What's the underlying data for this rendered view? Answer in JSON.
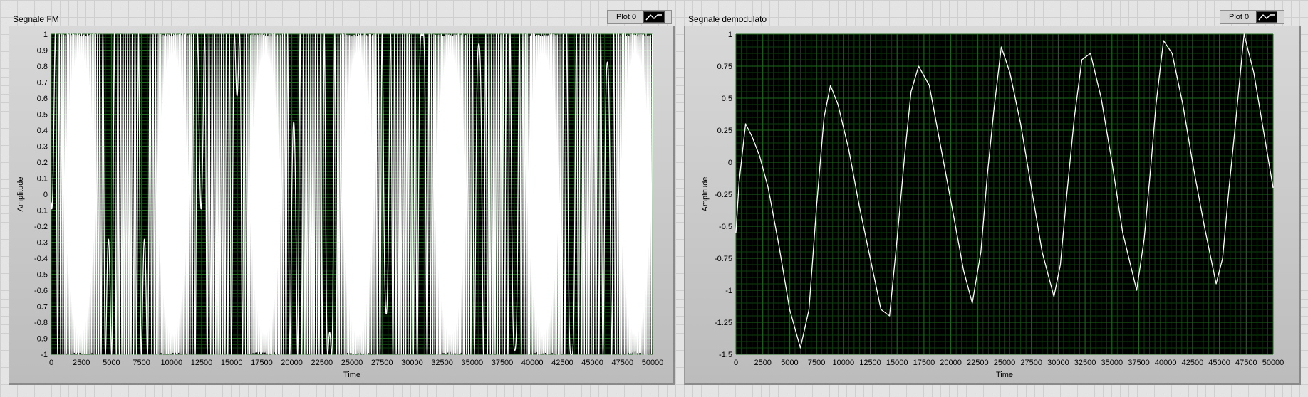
{
  "graphs": [
    {
      "title": "Segnale FM",
      "legend_label": "Plot 0",
      "chart_data": {
        "type": "line",
        "title": "Segnale FM",
        "xlabel": "Time",
        "ylabel": "Amplitude",
        "xlim": [
          0,
          50000
        ],
        "ylim": [
          -1,
          1
        ],
        "x_ticks": [
          "0",
          "2500",
          "5000",
          "7500",
          "10000",
          "12500",
          "15000",
          "17500",
          "20000",
          "22500",
          "25000",
          "27500",
          "30000",
          "32500",
          "35000",
          "37500",
          "40000",
          "42500",
          "45000",
          "47500",
          "50000"
        ],
        "y_ticks": [
          "1",
          "0.9",
          "0.8",
          "0.7",
          "0.6",
          "0.5",
          "0.4",
          "0.3",
          "0.2",
          "0.1",
          "0",
          "-0.1",
          "-0.2",
          "-0.3",
          "-0.4",
          "-0.5",
          "-0.6",
          "-0.7",
          "-0.8",
          "-0.9",
          "-1"
        ],
        "series": [
          {
            "name": "Plot 0",
            "description_params": {
              "signal": "cos(phase)",
              "num_samples": 50001,
              "carrier_cycles_over_range": 140,
              "deviation_cycles": 10,
              "modulation_period": 7700,
              "modulation_phase_offset_samples": 2400
            }
          }
        ],
        "grid": true,
        "colors": {
          "plot_bg": "#000000",
          "grid": "#1d6a1d",
          "trace": "#ffffff"
        }
      }
    },
    {
      "title": "Segnale demodulato",
      "legend_label": "Plot 0",
      "chart_data": {
        "type": "line",
        "title": "Segnale demodulato",
        "xlabel": "Time",
        "ylabel": "Amplitude",
        "xlim": [
          0,
          50000
        ],
        "ylim": [
          -1.5,
          1
        ],
        "x_ticks": [
          "0",
          "2500",
          "5000",
          "7500",
          "10000",
          "12500",
          "15000",
          "17500",
          "20000",
          "22500",
          "25000",
          "27500",
          "30000",
          "32500",
          "35000",
          "37500",
          "40000",
          "42500",
          "45000",
          "47500",
          "50000"
        ],
        "y_ticks": [
          "1",
          "0.75",
          "0.5",
          "0.25",
          "0",
          "-0.25",
          "-0.5",
          "-0.75",
          "-1",
          "-1.25",
          "-1.5"
        ],
        "series": [
          {
            "name": "Plot 0",
            "x": [
              0,
              300,
              900,
              1500,
              2200,
              3000,
              4000,
              5000,
              6000,
              6800,
              7500,
              8200,
              8800,
              9500,
              10500,
              11500,
              12500,
              13500,
              14300,
              15000,
              15700,
              16300,
              17000,
              18000,
              19000,
              20000,
              21200,
              22000,
              22800,
              23400,
              24000,
              24700,
              25500,
              26500,
              27500,
              28500,
              29600,
              30200,
              30800,
              31500,
              32200,
              33000,
              34000,
              35000,
              36000,
              37300,
              38000,
              38600,
              39100,
              39800,
              40600,
              41600,
              42600,
              43600,
              44700,
              45300,
              45900,
              46500,
              47300,
              48200,
              49000,
              50000
            ],
            "values": [
              -0.55,
              -0.15,
              0.3,
              0.2,
              0.05,
              -0.2,
              -0.65,
              -1.15,
              -1.45,
              -1.15,
              -0.35,
              0.35,
              0.6,
              0.45,
              0.1,
              -0.35,
              -0.75,
              -1.15,
              -1.2,
              -0.6,
              0.05,
              0.55,
              0.75,
              0.6,
              0.15,
              -0.3,
              -0.85,
              -1.1,
              -0.7,
              -0.1,
              0.4,
              0.9,
              0.7,
              0.3,
              -0.2,
              -0.7,
              -1.05,
              -0.8,
              -0.25,
              0.35,
              0.8,
              0.85,
              0.5,
              0.0,
              -0.55,
              -1.0,
              -0.6,
              -0.05,
              0.45,
              0.95,
              0.85,
              0.45,
              -0.05,
              -0.5,
              -0.95,
              -0.75,
              -0.2,
              0.3,
              1.0,
              0.7,
              0.3,
              -0.2
            ]
          }
        ],
        "grid": true,
        "colors": {
          "plot_bg": "#000000",
          "grid": "#1d6a1d",
          "trace": "#ffffff"
        }
      }
    }
  ]
}
